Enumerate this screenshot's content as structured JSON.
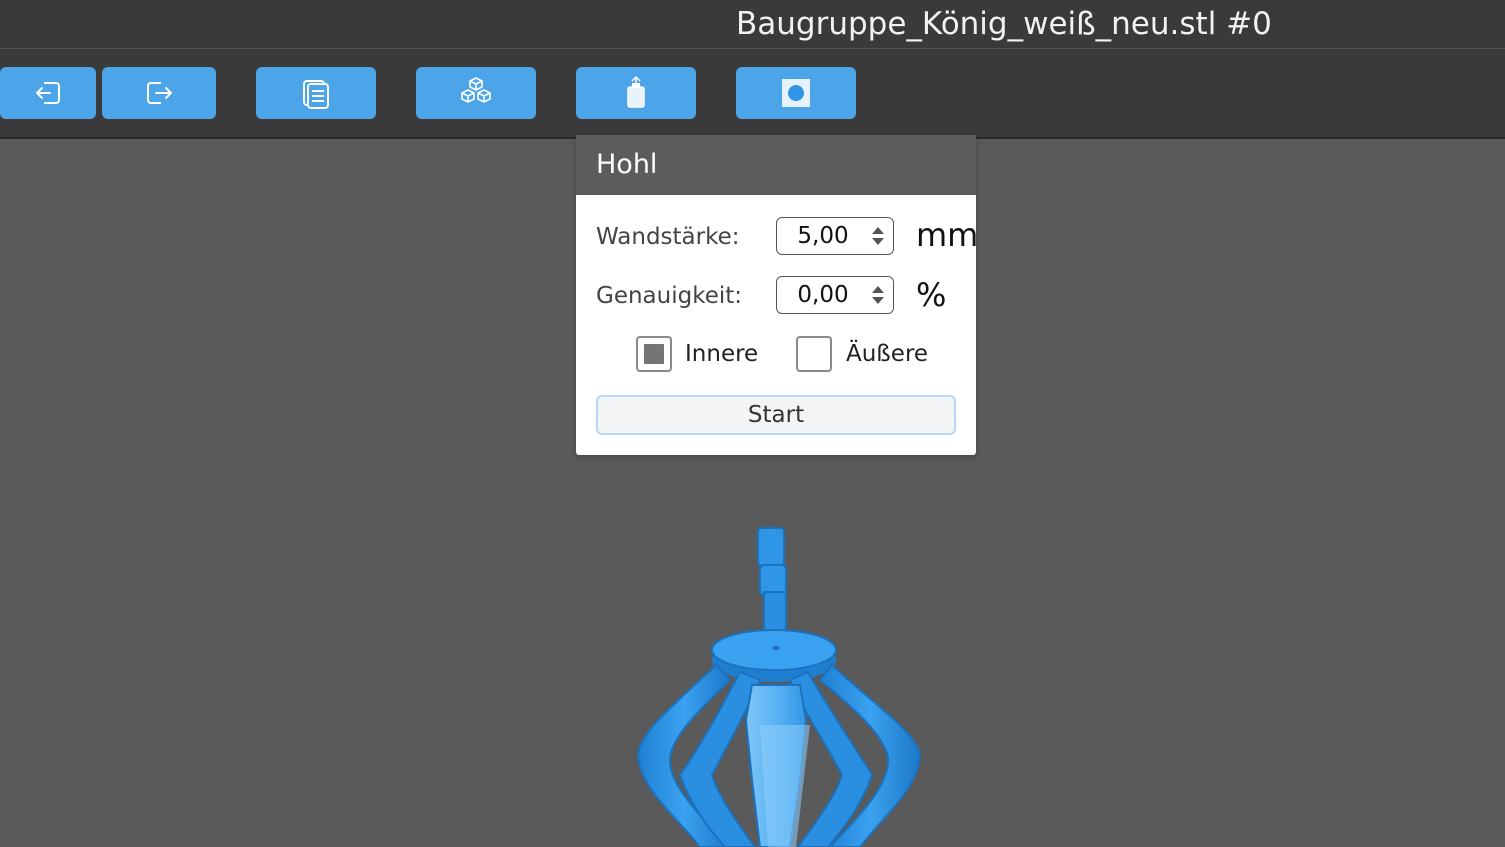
{
  "window": {
    "title": "Baugruppe_König_weiß_neu.stl #0"
  },
  "toolbar": {
    "buttons": [
      {
        "name": "import",
        "icon": "import-icon"
      },
      {
        "name": "export",
        "icon": "export-icon"
      },
      {
        "name": "copy",
        "icon": "copy-icon"
      },
      {
        "name": "arrange",
        "icon": "cubes-icon"
      },
      {
        "name": "hollow",
        "icon": "hollow-bottle-icon"
      },
      {
        "name": "drill",
        "icon": "hole-icon"
      }
    ]
  },
  "hollow_panel": {
    "title": "Hohl",
    "wall_thickness": {
      "label": "Wandstärke:",
      "value": "5,00",
      "unit": "mm"
    },
    "accuracy": {
      "label": "Genauigkeit:",
      "value": "0,00",
      "unit": "%"
    },
    "inner": {
      "label": "Innere",
      "checked": true
    },
    "outer": {
      "label": "Äußere",
      "checked": false
    },
    "start_label": "Start"
  },
  "colors": {
    "accent": "#4ba5e8",
    "model": "#2f95e6",
    "background": "#5a5a5a",
    "bar": "#3a3a3a"
  }
}
